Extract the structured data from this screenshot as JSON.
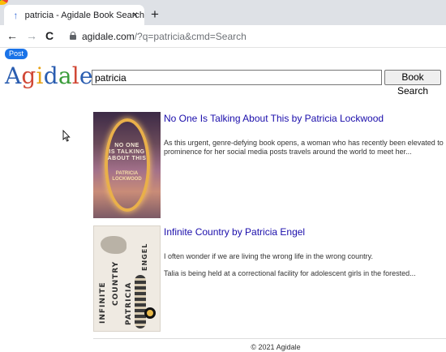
{
  "browser": {
    "tab": {
      "title": "patricia - Agidale Book Search",
      "close": "×"
    },
    "new_tab": "+",
    "nav": {
      "back": "←",
      "forward": "→",
      "reload": "C"
    },
    "url": {
      "host": "agidale.com",
      "path": "/?q=patricia&cmd=Search"
    }
  },
  "page": {
    "badge": "Post",
    "logo": {
      "letters": [
        {
          "ch": "A",
          "color": "#2a5db0"
        },
        {
          "ch": "g",
          "color": "#d14836"
        },
        {
          "ch": "i",
          "color": "#e8a317"
        },
        {
          "ch": "d",
          "color": "#2a5db0"
        },
        {
          "ch": "a",
          "color": "#3a9c3a"
        },
        {
          "ch": "l",
          "color": "#d14836"
        },
        {
          "ch": "e",
          "color": "#2a5db0"
        }
      ]
    },
    "search": {
      "value": "patricia",
      "button": "Book Search"
    },
    "results": [
      {
        "title": "No One Is Talking About This by Patricia Lockwood",
        "paragraphs": [
          "As this urgent, genre-defying book opens, a woman who has recently been elevated to prominence for her social media posts travels around the world to meet her..."
        ],
        "cover": {
          "lines": [
            "NO ONE",
            "IS TALKING",
            "ABOUT THIS"
          ],
          "author": [
            "PATRICIA",
            "LOCKWOOD"
          ]
        }
      },
      {
        "title": "Infinite Country by Patricia Engel",
        "paragraphs": [
          "I often wonder if we are living the wrong life in the wrong country.",
          "Talia is being held at a correctional facility for adolescent girls in the forested..."
        ],
        "cover": {
          "words": [
            "INFINITE",
            "COUNTRY",
            "PATRICIA",
            "ENGEL"
          ]
        }
      }
    ],
    "footer": "© 2021 Agidale"
  }
}
